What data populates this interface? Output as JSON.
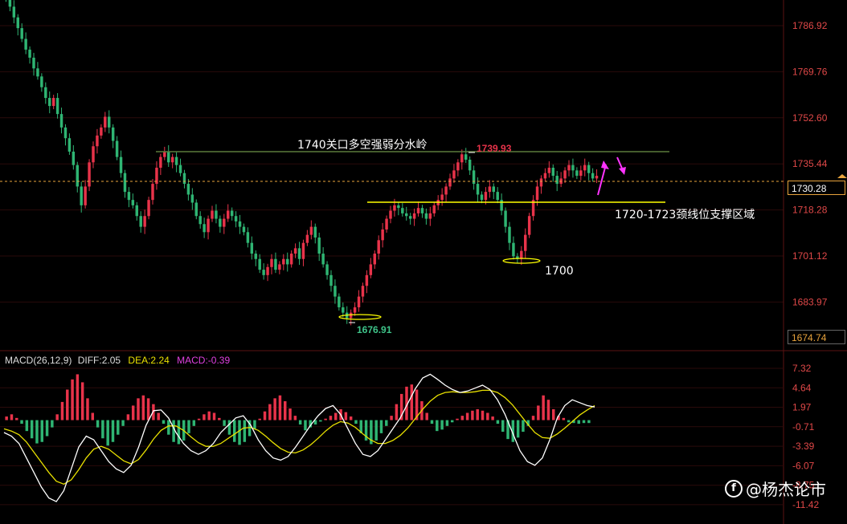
{
  "colors": {
    "up": "#e8334a",
    "down": "#2fb573",
    "grid": "#2a0a0a",
    "axis_text": "#e04848",
    "neck_line": "#ffff00",
    "resistance_line": "#5a7a3a",
    "current_line": "#e8a33c",
    "diff": "#ffffff",
    "dea": "#e8e000",
    "macd_hist_label": "#e040e0",
    "arrow": "#ff33ff"
  },
  "price_axis": {
    "ticks": [
      "1786.92",
      "1769.76",
      "1752.60",
      "1735.44",
      "1718.28",
      "1701.12",
      "1683.97"
    ],
    "current_price": "1730.28",
    "bottom_price": "1674.74"
  },
  "annotations": {
    "resistance": "1740关口多空强弱分水岭",
    "high_label": "1739.93",
    "low_label": "1676.91",
    "support": "1720-1723颈线位支撑区域",
    "low2": "1700"
  },
  "macd_legend": {
    "name": "MACD(26,12,9)",
    "diff": "DIFF:2.05",
    "dea": "DEA:2.24",
    "macd": "MACD:-0.39"
  },
  "macd_axis": {
    "ticks": [
      "7.32",
      "4.64",
      "1.97",
      "-0.71",
      "-3.39",
      "-6.07",
      "-8.75",
      "-11.42"
    ]
  },
  "watermark": {
    "icon": "f-logo-icon",
    "text": "@杨杰论市"
  },
  "chart_data": {
    "type": "candlestick",
    "price_ylim": [
      1674.74,
      1795
    ],
    "resistance_level": 1740,
    "support_zone": [
      1720,
      1723
    ],
    "current_price": 1730.28,
    "high_point": 1739.93,
    "low_point": 1676.91,
    "low2": 1700,
    "close_path": [
      1797,
      1794,
      1790,
      1786,
      1782,
      1778,
      1775,
      1771,
      1768,
      1764,
      1760,
      1757,
      1760,
      1754,
      1749,
      1745,
      1740,
      1735,
      1727,
      1720,
      1727,
      1736,
      1742,
      1746,
      1749,
      1753,
      1749,
      1744,
      1738,
      1732,
      1725,
      1722,
      1720,
      1716,
      1712,
      1716,
      1722,
      1728,
      1734,
      1738,
      1740,
      1736,
      1738,
      1735,
      1732,
      1728,
      1724,
      1721,
      1716,
      1713,
      1710,
      1715,
      1718,
      1715,
      1712,
      1715,
      1718,
      1716,
      1714,
      1712,
      1710,
      1706,
      1702,
      1700,
      1696,
      1694,
      1697,
      1700,
      1696,
      1698,
      1700,
      1698,
      1702,
      1704,
      1700,
      1706,
      1709,
      1712,
      1708,
      1702,
      1698,
      1694,
      1690,
      1686,
      1682,
      1680,
      1678,
      1680,
      1682,
      1686,
      1690,
      1694,
      1698,
      1702,
      1707,
      1711,
      1715,
      1718,
      1720,
      1719,
      1717,
      1716,
      1715,
      1717,
      1719,
      1717,
      1715,
      1717,
      1720,
      1722,
      1724,
      1727,
      1730,
      1733,
      1736,
      1739,
      1737,
      1733,
      1728,
      1724,
      1722,
      1725,
      1727,
      1725,
      1722,
      1718,
      1712,
      1706,
      1701,
      1700,
      1703,
      1709,
      1716,
      1722,
      1727,
      1730,
      1732,
      1734,
      1731,
      1728,
      1730,
      1733,
      1735,
      1733,
      1731,
      1733,
      1735,
      1732,
      1730,
      1731
    ],
    "macd_ylim": [
      -12.5,
      8.2
    ],
    "macd_hist": [
      0.5,
      0.8,
      0.3,
      -0.5,
      -1.5,
      -2.5,
      -3.2,
      -3.0,
      -2.2,
      -1.0,
      0.8,
      2.5,
      4.2,
      5.6,
      6.3,
      5.2,
      3.0,
      1.0,
      -1.0,
      -2.5,
      -3.5,
      -3.0,
      -2.0,
      -0.8,
      0.8,
      2.0,
      3.0,
      3.4,
      3.0,
      2.2,
      1.0,
      -0.5,
      -2.0,
      -3.0,
      -3.3,
      -2.8,
      -1.8,
      -0.8,
      0.2,
      0.8,
      1.2,
      1.0,
      0.3,
      -0.8,
      -2.0,
      -3.0,
      -3.4,
      -3.0,
      -2.2,
      -1.2,
      0.2,
      1.2,
      2.2,
      3.0,
      3.4,
      2.6,
      1.6,
      0.6,
      -0.6,
      -1.4,
      -1.0,
      -0.6,
      -0.2,
      0.2,
      0.6,
      1.0,
      1.5,
      1.1,
      0.5,
      -0.5,
      -1.8,
      -2.8,
      -3.3,
      -2.8,
      -1.8,
      -0.8,
      0.6,
      2.2,
      3.6,
      4.6,
      4.9,
      4.2,
      2.6,
      1.0,
      -0.5,
      -1.5,
      -1.3,
      -0.8,
      -0.3,
      0.2,
      0.6,
      1.0,
      1.3,
      1.5,
      1.3,
      1.0,
      0.5,
      -0.5,
      -1.6,
      -2.6,
      -3.0,
      -2.4,
      -1.6,
      -0.8,
      0.6,
      2.0,
      3.4,
      2.8,
      1.5,
      0.6,
      0.3,
      -0.3,
      -0.4,
      -0.5,
      -0.4,
      -0.4
    ],
    "diff": [
      -1.5,
      -2.0,
      -3.0,
      -5.0,
      -7.0,
      -9.0,
      -10.5,
      -11.0,
      -9.5,
      -6.5,
      -3.5,
      -2.0,
      -2.5,
      -4.0,
      -5.5,
      -6.5,
      -7.0,
      -6.0,
      -3.5,
      -0.5,
      1.5,
      1.6,
      0.5,
      -1.5,
      -3.0,
      -4.0,
      -4.5,
      -4.0,
      -3.0,
      -1.5,
      -0.5,
      0.5,
      0.8,
      -0.5,
      -2.5,
      -4.0,
      -5.0,
      -5.3,
      -4.8,
      -3.5,
      -2.0,
      -0.5,
      0.8,
      1.8,
      2.2,
      1.0,
      -1.0,
      -3.0,
      -4.5,
      -4.8,
      -4.0,
      -2.5,
      -1.0,
      0.5,
      2.5,
      4.5,
      6.0,
      6.5,
      5.8,
      5.0,
      4.4,
      4.0,
      4.2,
      4.6,
      5.0,
      4.4,
      3.0,
      1.0,
      -1.5,
      -4.0,
      -5.5,
      -6.0,
      -5.0,
      -2.5,
      0.5,
      2.2,
      3.0,
      2.6,
      2.2,
      2.0
    ],
    "dea": [
      -1.0,
      -1.3,
      -1.8,
      -2.8,
      -4.2,
      -5.6,
      -7.0,
      -8.2,
      -8.6,
      -8.0,
      -6.6,
      -5.0,
      -3.8,
      -3.4,
      -3.8,
      -4.6,
      -5.4,
      -5.8,
      -5.2,
      -3.9,
      -2.4,
      -1.2,
      -0.6,
      -0.6,
      -1.2,
      -2.1,
      -2.9,
      -3.4,
      -3.4,
      -3.0,
      -2.3,
      -1.6,
      -0.9,
      -0.8,
      -1.2,
      -2.0,
      -2.9,
      -3.7,
      -4.2,
      -4.3,
      -3.9,
      -3.2,
      -2.3,
      -1.3,
      -0.5,
      0.0,
      -0.2,
      -0.8,
      -1.7,
      -2.5,
      -3.0,
      -3.0,
      -2.6,
      -1.9,
      -0.9,
      0.4,
      1.7,
      2.8,
      3.6,
      4.0,
      4.1,
      4.0,
      4.0,
      4.1,
      4.3,
      4.3,
      4.0,
      3.3,
      2.3,
      1.0,
      -0.3,
      -1.5,
      -2.2,
      -2.3,
      -1.7,
      -0.9,
      0.0,
      0.9,
      1.6,
      2.2
    ]
  }
}
